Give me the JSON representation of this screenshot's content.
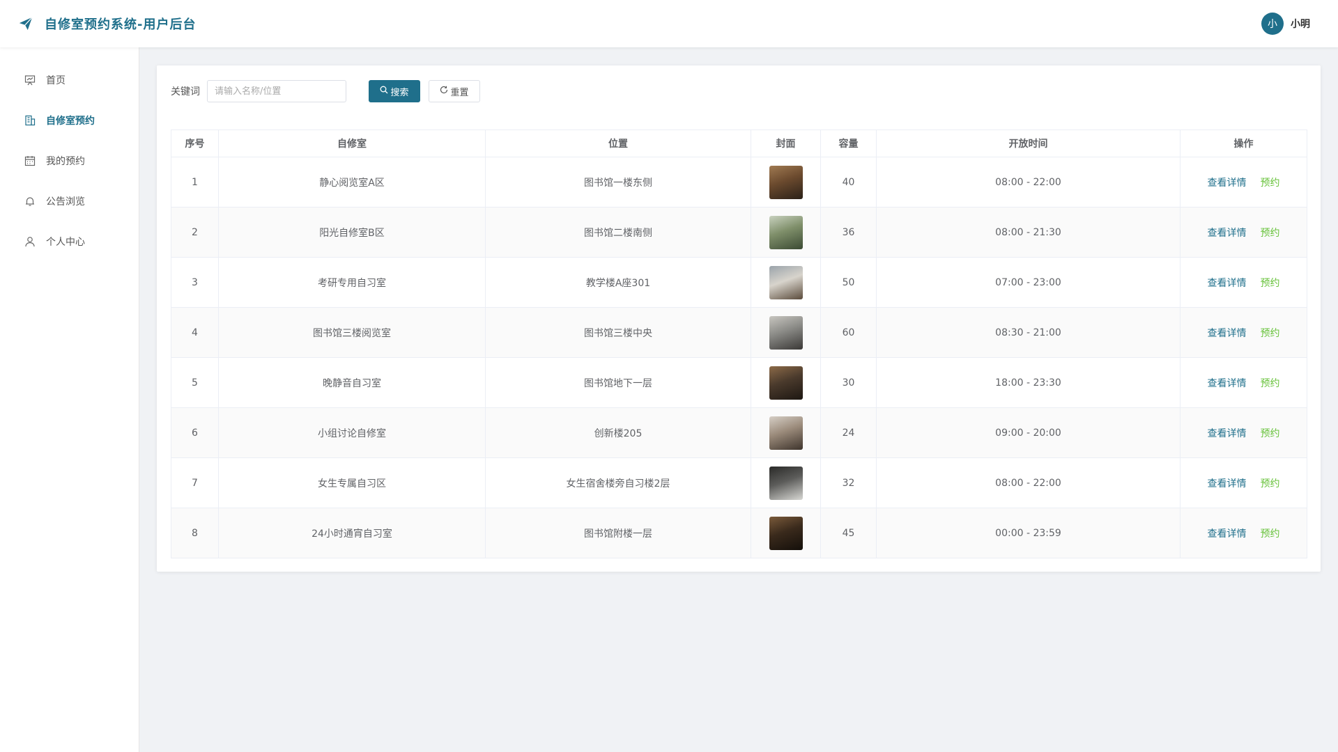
{
  "header": {
    "title": "自修室预约系统-用户后台",
    "avatar_text": "小",
    "user_name": "小明"
  },
  "sidebar": {
    "items": [
      {
        "label": "首页",
        "icon": "presentation-icon",
        "active": false
      },
      {
        "label": "自修室预约",
        "icon": "building-icon",
        "active": true
      },
      {
        "label": "我的预约",
        "icon": "calendar-icon",
        "active": false
      },
      {
        "label": "公告浏览",
        "icon": "bell-icon",
        "active": false
      },
      {
        "label": "个人中心",
        "icon": "user-icon",
        "active": false
      }
    ]
  },
  "search": {
    "label": "关键词",
    "placeholder": "请输入名称/位置",
    "value": "",
    "search_label": "搜索",
    "reset_label": "重置"
  },
  "table": {
    "headers": [
      "序号",
      "自修室",
      "位置",
      "封面",
      "容量",
      "开放时间",
      "操作"
    ],
    "detail_label": "查看详情",
    "reserve_label": "预约",
    "rows": [
      {
        "index": "1",
        "name": "静心阅览室A区",
        "location": "图书馆一楼东侧",
        "capacity": "40",
        "hours": "08:00 - 22:00",
        "cover_colors": [
          "#6b4a2e",
          "#2b2118",
          "#a07a52"
        ]
      },
      {
        "index": "2",
        "name": "阳光自修室B区",
        "location": "图书馆二楼南侧",
        "capacity": "36",
        "hours": "08:00 - 21:30",
        "cover_colors": [
          "#7f8f6a",
          "#3b4a33",
          "#c9d2c0"
        ]
      },
      {
        "index": "3",
        "name": "考研专用自习室",
        "location": "教学楼A座301",
        "capacity": "50",
        "hours": "07:00 - 23:00",
        "cover_colors": [
          "#d8d4cc",
          "#5a4a3a",
          "#9aa3aa"
        ]
      },
      {
        "index": "4",
        "name": "图书馆三楼阅览室",
        "location": "图书馆三楼中央",
        "capacity": "60",
        "hours": "08:30 - 21:00",
        "cover_colors": [
          "#8a8a86",
          "#3a3836",
          "#c8c6c0"
        ]
      },
      {
        "index": "5",
        "name": "晚静音自习室",
        "location": "图书馆地下一层",
        "capacity": "30",
        "hours": "18:00 - 23:30",
        "cover_colors": [
          "#4a3a2c",
          "#1d1712",
          "#8c6a48"
        ]
      },
      {
        "index": "6",
        "name": "小组讨论自修室",
        "location": "创新楼205",
        "capacity": "24",
        "hours": "09:00 - 20:00",
        "cover_colors": [
          "#9a8a7a",
          "#3e342c",
          "#d6cfc6"
        ]
      },
      {
        "index": "7",
        "name": "女生专属自习区",
        "location": "女生宿舍楼旁自习楼2层",
        "capacity": "32",
        "hours": "08:00 - 22:00",
        "cover_colors": [
          "#5c5c5a",
          "#d8d8d4",
          "#2a2a28"
        ]
      },
      {
        "index": "8",
        "name": "24小时通宵自习室",
        "location": "图书馆附楼一层",
        "capacity": "45",
        "hours": "00:00 - 23:59",
        "cover_colors": [
          "#3a2a1c",
          "#140f0a",
          "#7a5a3a"
        ]
      }
    ]
  },
  "colors": {
    "primary": "#1f6f8b",
    "reserve": "#67c23a"
  }
}
